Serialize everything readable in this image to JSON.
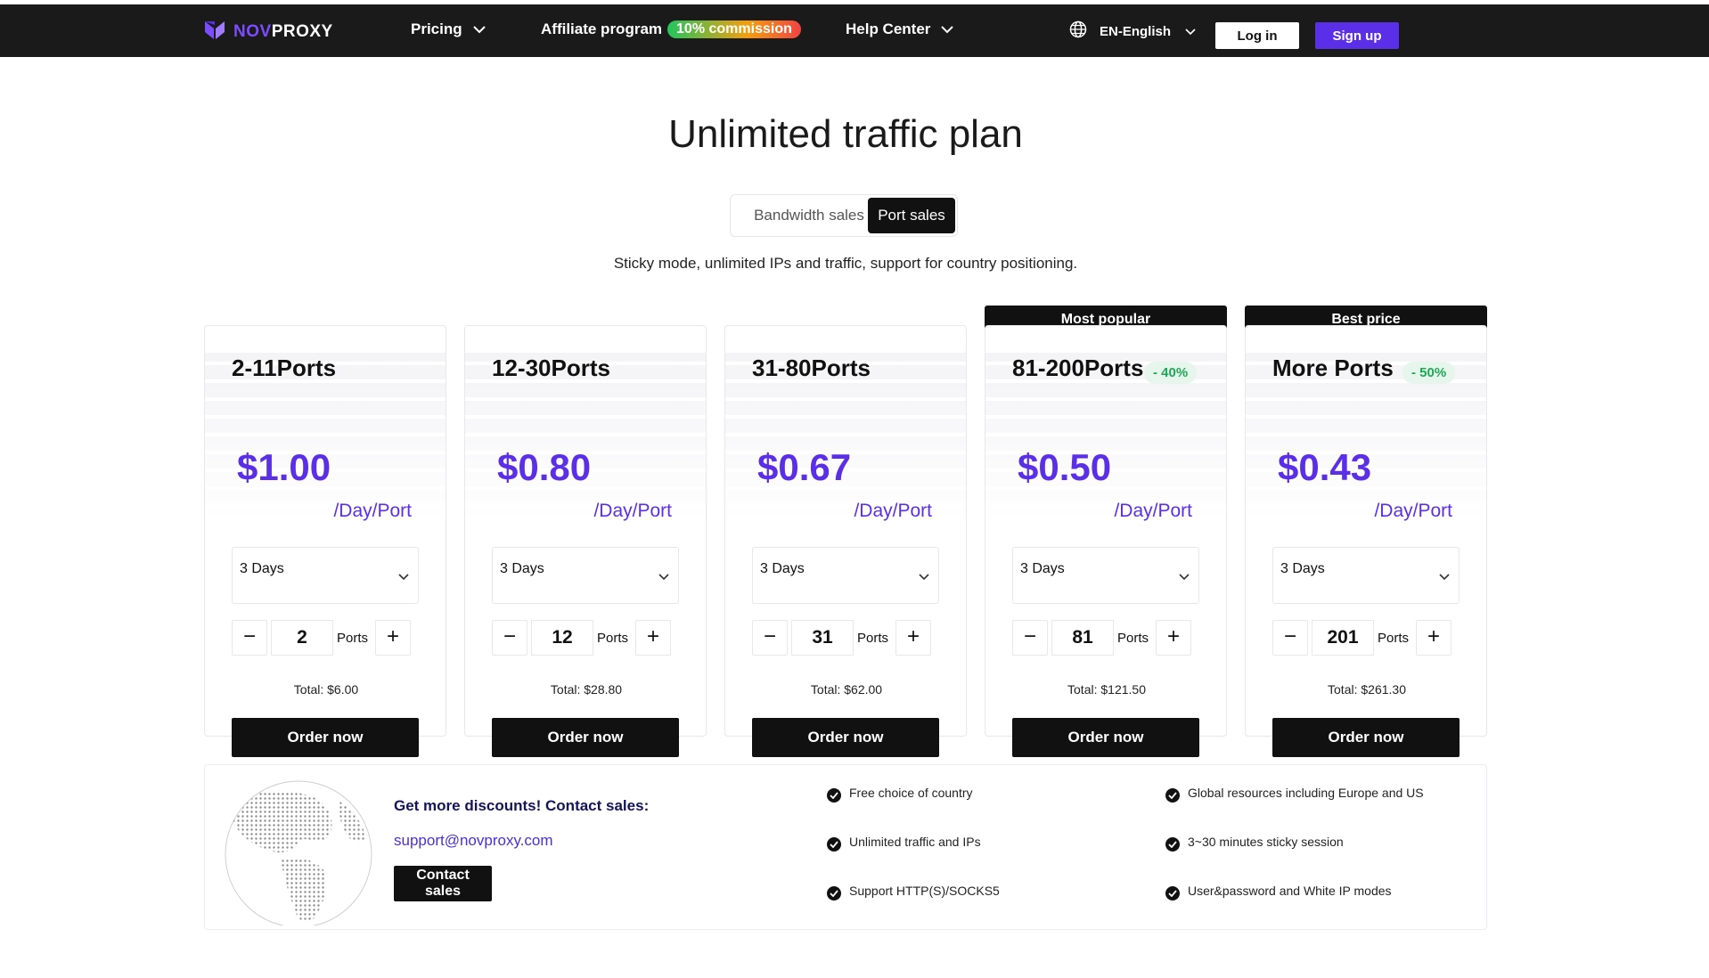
{
  "nav": {
    "logo_nov": "NOV",
    "logo_proxy": "PROXY",
    "pricing_label": "Pricing",
    "affiliate_label": "Affiliate program",
    "affiliate_badge": "10% commission",
    "help_label": "Help Center",
    "language": "EN-English",
    "login_label": "Log in",
    "signup_label": "Sign up"
  },
  "hero": {
    "title": "Unlimited traffic plan",
    "tabs": [
      {
        "label": "Bandwidth sales",
        "active": false
      },
      {
        "label": "Port sales",
        "active": true
      }
    ],
    "subtitle": "Sticky mode, unlimited IPs and traffic, support for country positioning."
  },
  "plans": [
    {
      "title": "2-11Ports",
      "ribbon": "",
      "discount": "",
      "price": "$1.00",
      "unit": "/Day/Port",
      "duration": "3 Days",
      "quantity": "2",
      "qty_unit": "Ports",
      "total": "Total: $6.00",
      "order_label": "Order now"
    },
    {
      "title": "12-30Ports",
      "ribbon": "",
      "discount": "",
      "price": "$0.80",
      "unit": "/Day/Port",
      "duration": "3 Days",
      "quantity": "12",
      "qty_unit": "Ports",
      "total": "Total: $28.80",
      "order_label": "Order now"
    },
    {
      "title": "31-80Ports",
      "ribbon": "",
      "discount": "",
      "price": "$0.67",
      "unit": "/Day/Port",
      "duration": "3 Days",
      "quantity": "31",
      "qty_unit": "Ports",
      "total": "Total: $62.00",
      "order_label": "Order now"
    },
    {
      "title": "81-200Ports",
      "ribbon": "Most popular",
      "discount": "- 40%",
      "price": "$0.50",
      "unit": "/Day/Port",
      "duration": "3 Days",
      "quantity": "81",
      "qty_unit": "Ports",
      "total": "Total: $121.50",
      "order_label": "Order now"
    },
    {
      "title": "More Ports",
      "ribbon": "Best price",
      "discount": "- 50%",
      "price": "$0.43",
      "unit": "/Day/Port",
      "duration": "3 Days",
      "quantity": "201",
      "qty_unit": "Ports",
      "total": "Total: $261.30",
      "order_label": "Order now"
    }
  ],
  "contact": {
    "heading": "Get more discounts! Contact sales:",
    "email": "support@novproxy.com",
    "button_label": "Contact sales"
  },
  "features": [
    "Free choice of country",
    "Global resources including Europe and US",
    "Unlimited traffic and IPs",
    "3~30 minutes sticky session",
    "Support HTTP(S)/SOCKS5",
    "User&password and White IP modes"
  ],
  "colors": {
    "accent": "#5b2fe8",
    "nav_bg": "#1a1a1a",
    "discount_green": "#1fa855"
  }
}
